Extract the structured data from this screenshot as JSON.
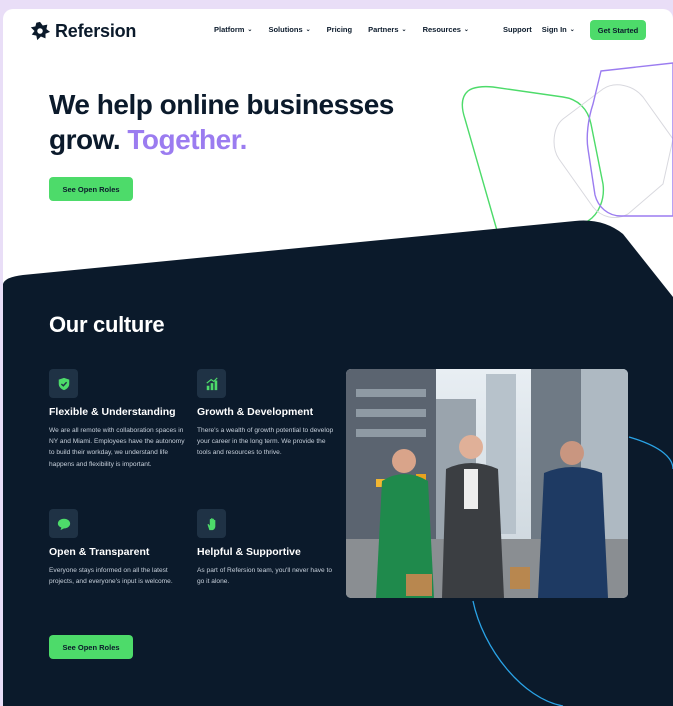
{
  "brand": {
    "name": "Refersion"
  },
  "nav": {
    "menu": [
      {
        "label": "Platform",
        "dropdown": true
      },
      {
        "label": "Solutions",
        "dropdown": true
      },
      {
        "label": "Pricing",
        "dropdown": false
      },
      {
        "label": "Partners",
        "dropdown": true
      },
      {
        "label": "Resources",
        "dropdown": true
      }
    ],
    "support": "Support",
    "sign_in": "Sign In",
    "cta": "Get Started"
  },
  "hero": {
    "title_line1": "We help online businesses",
    "title_line2_plain": "grow.",
    "title_line2_accent": "Together.",
    "cta": "See Open Roles"
  },
  "culture": {
    "title": "Our culture",
    "features": [
      {
        "icon": "shield-check-icon",
        "title": "Flexible & Understanding",
        "text": "We are all remote with collaboration spaces in NY and Miami. Employees have the autonomy to build their workday, we understand life happens and flexibility is important."
      },
      {
        "icon": "growth-chart-icon",
        "title": "Growth & Development",
        "text": "There's a wealth of growth potential to develop your career in the long term. We provide the tools and resources to thrive."
      },
      {
        "icon": "chat-bubble-icon",
        "title": "Open & Transparent",
        "text": "Everyone stays informed on all the latest projects, and everyone's input is welcome."
      },
      {
        "icon": "raised-hand-icon",
        "title": "Helpful & Supportive",
        "text": "As part of Refersion team, you'll never have to go it alone."
      }
    ],
    "cta": "See Open Roles"
  },
  "colors": {
    "brand_green": "#4ddb6a",
    "accent_purple": "#9b7cf0",
    "dark_navy": "#0b1a2b",
    "icon_tile": "#1f3245",
    "frame_bg": "#e9def7"
  }
}
